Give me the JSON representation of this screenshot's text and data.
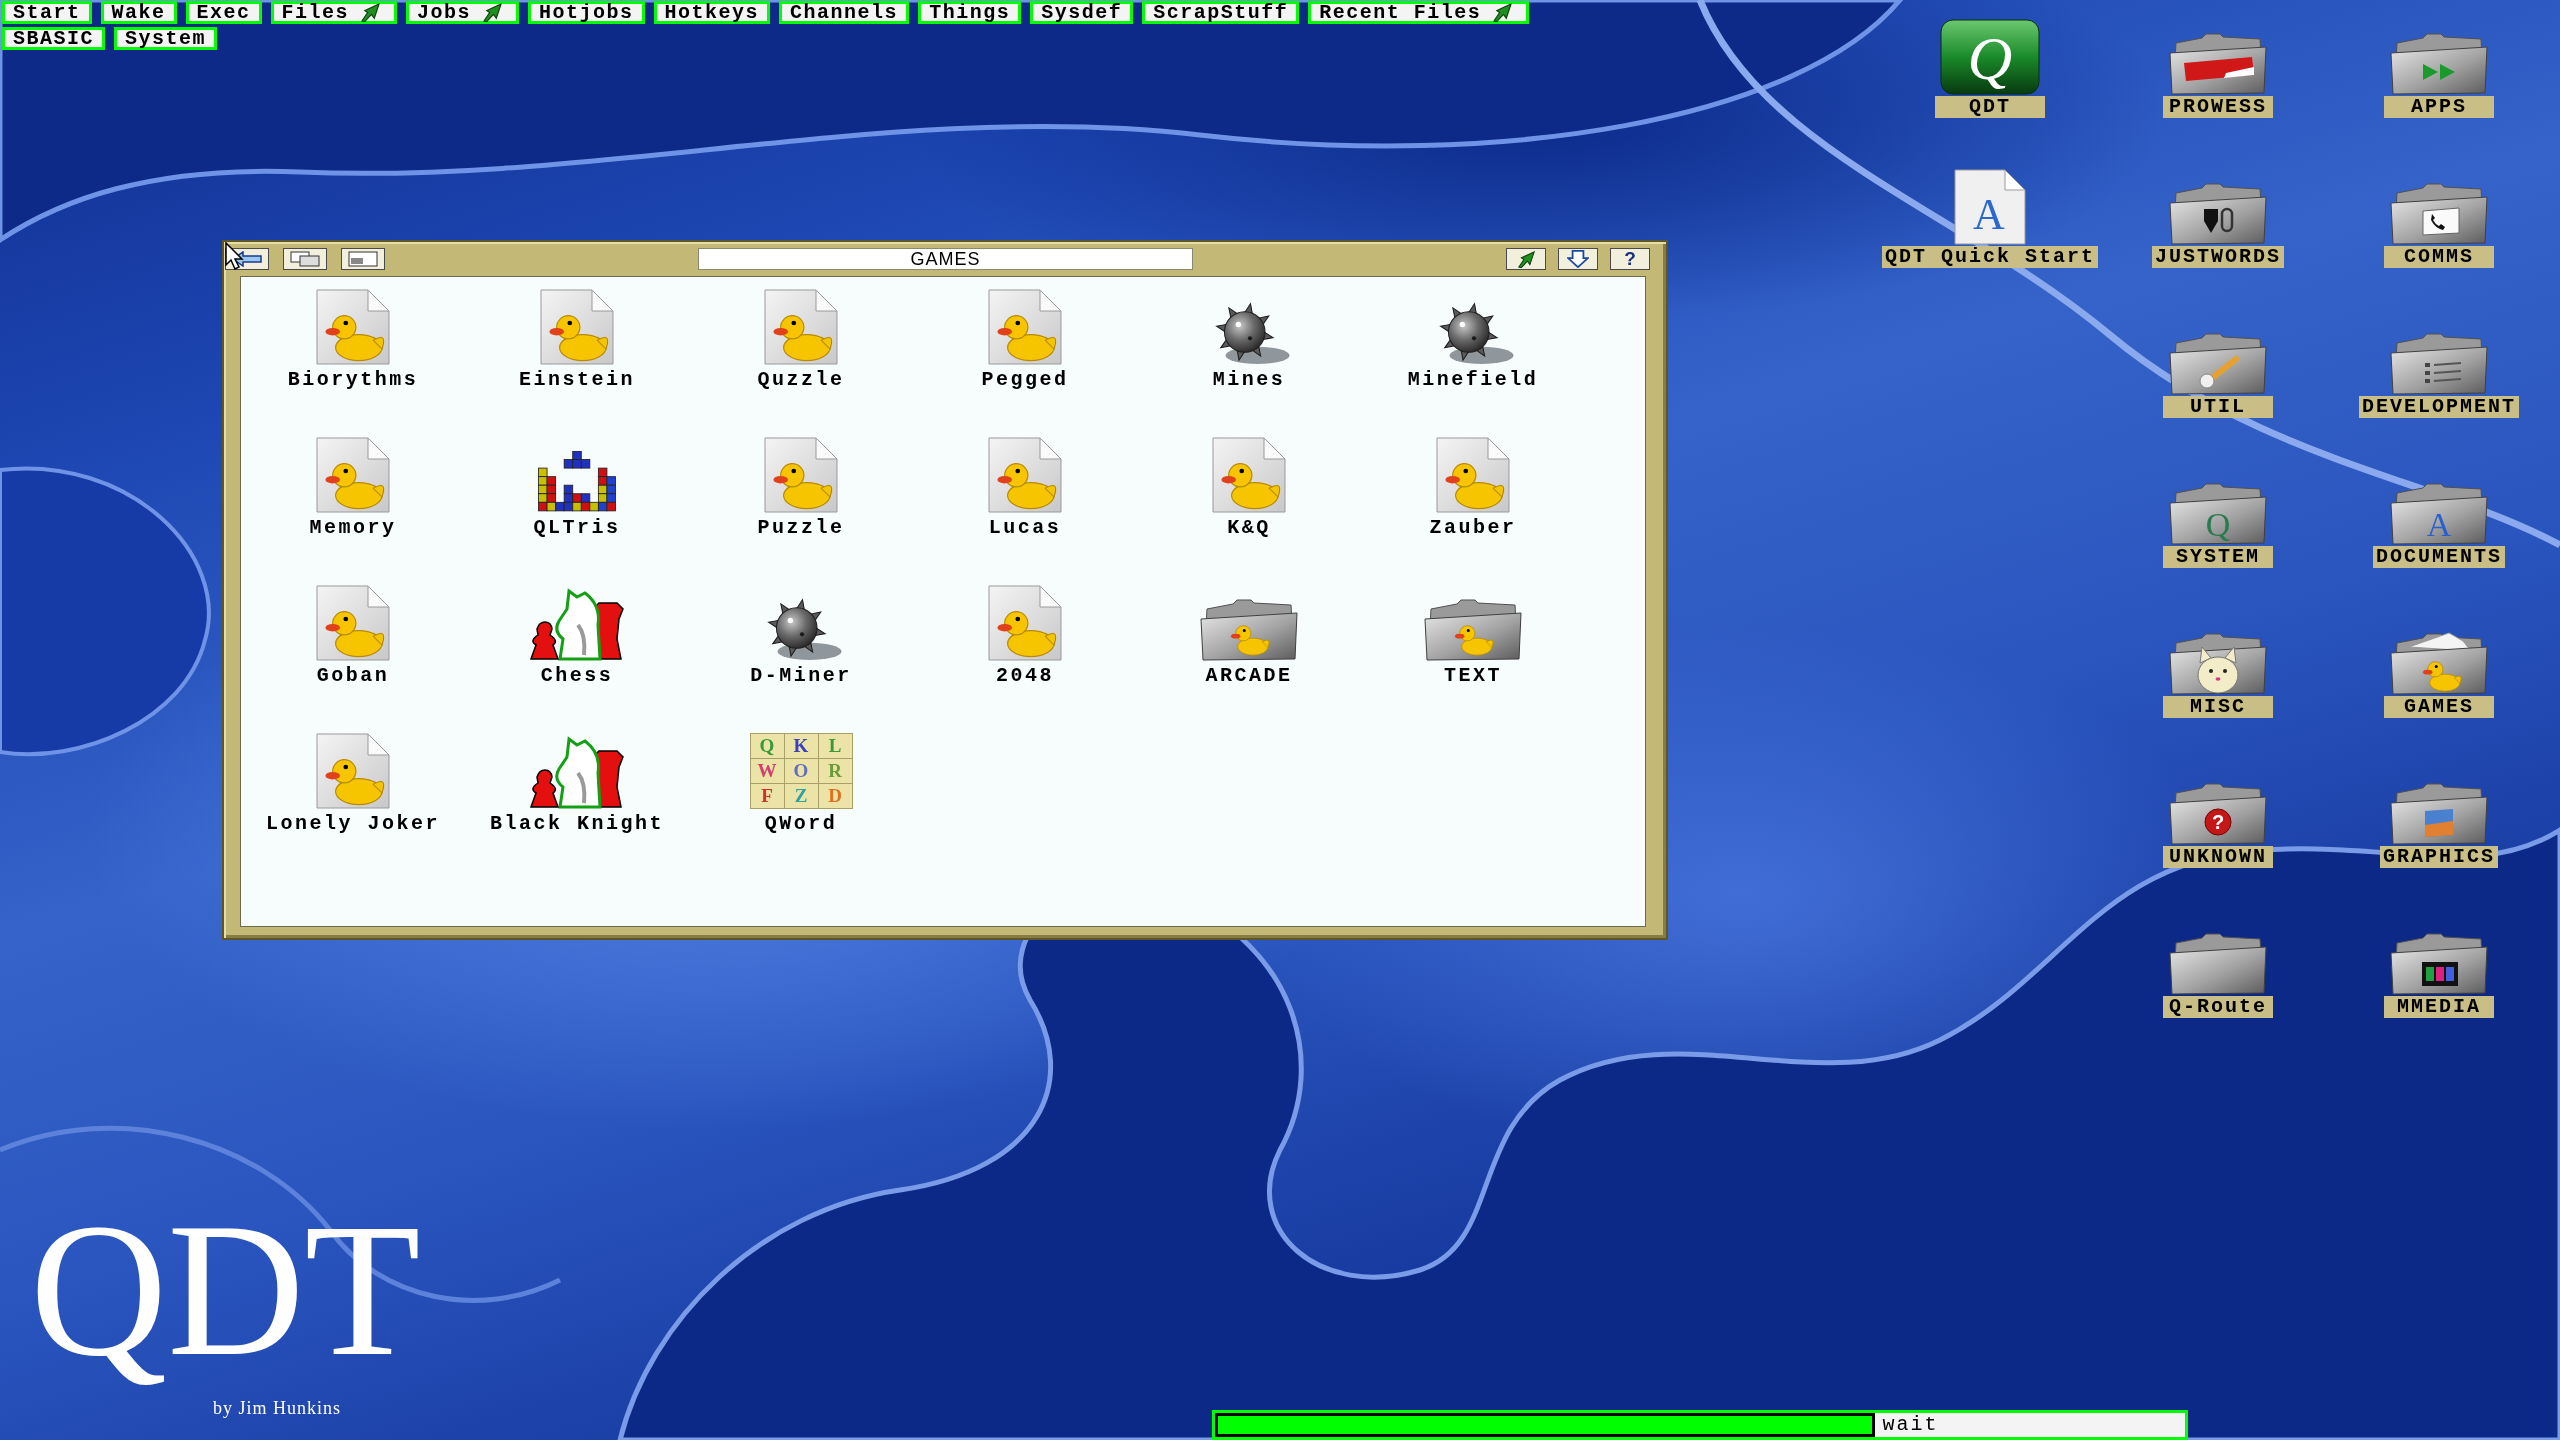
{
  "menu": {
    "rows": [
      [
        {
          "label": "Start",
          "has_submenu": false
        },
        {
          "label": "Wake",
          "has_submenu": false
        },
        {
          "label": "Exec",
          "has_submenu": false
        },
        {
          "label": "Files",
          "has_submenu": true
        },
        {
          "label": "Jobs",
          "has_submenu": true
        },
        {
          "label": "Hotjobs",
          "has_submenu": false
        },
        {
          "label": "Hotkeys",
          "has_submenu": false
        },
        {
          "label": "Channels",
          "has_submenu": false
        },
        {
          "label": "Things",
          "has_submenu": false
        },
        {
          "label": "Sysdef",
          "has_submenu": false
        },
        {
          "label": "ScrapStuff",
          "has_submenu": false
        },
        {
          "label": "Recent Files",
          "has_submenu": true
        }
      ],
      [
        {
          "label": "SBASIC",
          "has_submenu": false
        },
        {
          "label": "System",
          "has_submenu": false
        }
      ]
    ]
  },
  "window": {
    "title": "GAMES",
    "help_button": "?",
    "items": [
      {
        "label": "Biorythms",
        "kind": "duckpage"
      },
      {
        "label": "Einstein",
        "kind": "duckpage"
      },
      {
        "label": "Quzzle",
        "kind": "duckpage"
      },
      {
        "label": "Pegged",
        "kind": "duckpage"
      },
      {
        "label": "Mines",
        "kind": "mine"
      },
      {
        "label": "Minefield",
        "kind": "mine"
      },
      {
        "label": "Memory",
        "kind": "duckpage"
      },
      {
        "label": "QLTris",
        "kind": "tetris"
      },
      {
        "label": "Puzzle",
        "kind": "duckpage"
      },
      {
        "label": "Lucas",
        "kind": "duckpage"
      },
      {
        "label": "K&Q",
        "kind": "duckpage"
      },
      {
        "label": "Zauber",
        "kind": "duckpage"
      },
      {
        "label": "Goban",
        "kind": "duckpage"
      },
      {
        "label": "Chess",
        "kind": "chess"
      },
      {
        "label": "D-Miner",
        "kind": "mine"
      },
      {
        "label": "2048",
        "kind": "duckpage"
      },
      {
        "label": "ARCADE",
        "kind": "duckfolder"
      },
      {
        "label": "TEXT",
        "kind": "duckfolder"
      },
      {
        "label": "Lonely Joker",
        "kind": "duckpage"
      },
      {
        "label": "Black Knight",
        "kind": "chess"
      },
      {
        "label": "QWord",
        "kind": "letters",
        "tiles": [
          "Q",
          "K",
          "L",
          "W",
          "O",
          "R",
          "F",
          "Z",
          "D"
        ]
      }
    ]
  },
  "desktop_icons": {
    "columns": [
      [
        {
          "label": "QDT",
          "kind": "app",
          "glyph": "Q"
        },
        {
          "label": "QDT Quick Start",
          "kind": "page",
          "glyph": "A"
        }
      ],
      [
        {
          "label": "PROWESS",
          "kind": "banner"
        },
        {
          "label": "JUSTWORDS",
          "kind": "pen"
        },
        {
          "label": "UTIL",
          "kind": "wrench"
        },
        {
          "label": "SYSTEM",
          "kind": "sysfolder",
          "glyph": "Q"
        },
        {
          "label": "MISC",
          "kind": "cat"
        },
        {
          "label": "UNKNOWN",
          "kind": "question",
          "glyph": "?"
        },
        {
          "label": "Q-Route",
          "kind": "plain"
        }
      ],
      [
        {
          "label": "APPS",
          "kind": "forward"
        },
        {
          "label": "COMMS",
          "kind": "phone"
        },
        {
          "label": "DEVELOPMENT",
          "kind": "list"
        },
        {
          "label": "DOCUMENTS",
          "kind": "docfolder",
          "glyph": "A"
        },
        {
          "label": "GAMES",
          "kind": "duck"
        },
        {
          "label": "GRAPHICS",
          "kind": "picture"
        },
        {
          "label": "MMEDIA",
          "kind": "film"
        }
      ]
    ]
  },
  "logo": {
    "title": "QDT",
    "byline": "by Jim Hunkins"
  },
  "status_bar": {
    "level": 0.68,
    "text": "wait"
  }
}
